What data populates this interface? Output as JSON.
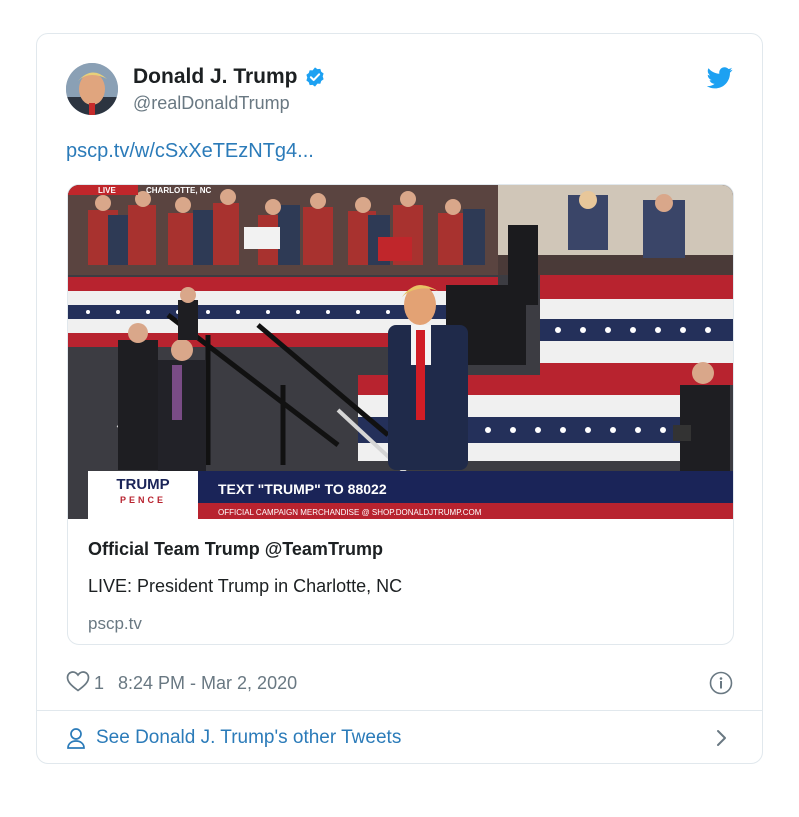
{
  "tweet": {
    "author": {
      "display_name": "Donald J. Trump",
      "handle": "@realDonaldTrump",
      "verified": true,
      "avatar_icon": "avatar-photo"
    },
    "link_text": "pscp.tv/w/cSxXeTEzNTg4...",
    "card": {
      "title": "Official Team Trump @TeamTrump",
      "description": "LIVE: President Trump in Charlotte, NC",
      "domain": "pscp.tv",
      "media": {
        "live_tag": "LIVE",
        "location_tag": "CHARLOTTE, NC",
        "logo_top": "TRUMP",
        "logo_bottom": "PENCE",
        "banner_main": "TEXT \"TRUMP\" TO 88022",
        "banner_sub": "OFFICIAL CAMPAIGN MERCHANDISE @ SHOP.DONALDJTRUMP.COM"
      }
    },
    "likes": "1",
    "timestamp": "8:24 PM - Mar 2, 2020",
    "more_tweets_label": "See Donald J. Trump's other Tweets"
  },
  "colors": {
    "link": "#2b7bb9",
    "muted": "#697882",
    "border": "#e1e8ed",
    "verified": "#1da1f2",
    "twitter_bird": "#1da1f2"
  },
  "icons": [
    "twitter-bird-icon",
    "verified-badge-icon",
    "heart-icon",
    "info-icon",
    "person-icon",
    "chevron-right-icon"
  ]
}
